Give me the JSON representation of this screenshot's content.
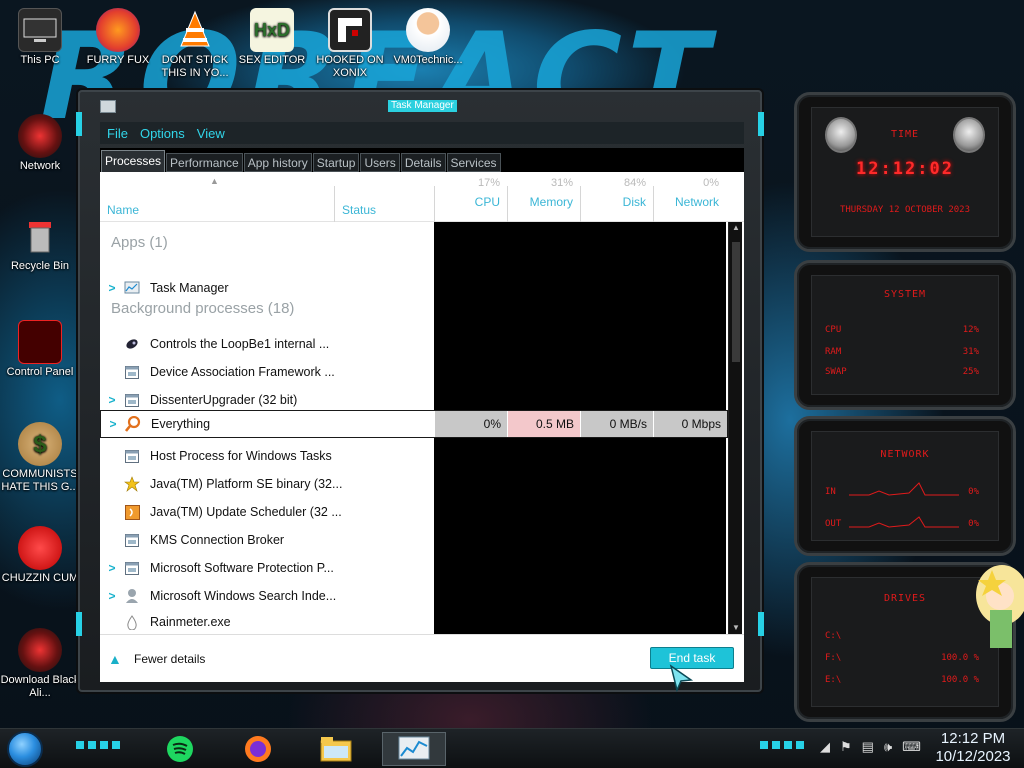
{
  "desktop": {
    "wallpaper_text": "ROREACT",
    "icons": [
      {
        "label": "This PC",
        "icon": "this-pc-icon"
      },
      {
        "label": "FURRY FUX",
        "icon": "firefox-icon"
      },
      {
        "label": "DONT STICK THIS IN YO...",
        "icon": "vlc-icon"
      },
      {
        "label": "SEX EDITOR",
        "icon": "hxd-editor-icon"
      },
      {
        "label": "HOOKED ON XONIX",
        "icon": "xonix-icon"
      },
      {
        "label": "VM0Technic...",
        "icon": "doctor-icon"
      },
      {
        "label": "Network",
        "icon": "network-icon"
      },
      {
        "label": "Recycle Bin",
        "icon": "recycle-bin-icon"
      },
      {
        "label": "Control Panel",
        "icon": "control-panel-icon"
      },
      {
        "label": "COMMUNISTS HATE THIS G...",
        "icon": "money-bag-icon"
      },
      {
        "label": "CHUZZIN CUM",
        "icon": "chuzzle-icon"
      },
      {
        "label": "Download Black Ali...",
        "icon": "alien-download-icon"
      }
    ]
  },
  "task_manager": {
    "title": "Task Manager",
    "menu": [
      "File",
      "Options",
      "View"
    ],
    "tabs": [
      "Processes",
      "Performance",
      "App history",
      "Startup",
      "Users",
      "Details",
      "Services"
    ],
    "active_tab": "Processes",
    "columns": {
      "name": "Name",
      "status": "Status",
      "cpu": {
        "label": "CPU",
        "pct": "17%"
      },
      "memory": {
        "label": "Memory",
        "pct": "31%"
      },
      "disk": {
        "label": "Disk",
        "pct": "84%"
      },
      "network": {
        "label": "Network",
        "pct": "0%"
      }
    },
    "groups": {
      "apps": "Apps (1)",
      "background": "Background processes (18)"
    },
    "processes": [
      {
        "name": "Task Manager",
        "expand": true,
        "icon": "task-manager-icon"
      },
      {
        "name": "Controls the LoopBe1 internal ...",
        "expand": false,
        "icon": "loopbe-icon"
      },
      {
        "name": "Device Association Framework ...",
        "expand": false,
        "icon": "service-window-icon"
      },
      {
        "name": "DissenterUpgrader (32 bit)",
        "expand": true,
        "icon": "service-window-icon"
      },
      {
        "name": "Everything",
        "expand": true,
        "icon": "magnifier-icon"
      },
      {
        "name": "Host Process for Windows Tasks",
        "expand": false,
        "icon": "service-window-icon"
      },
      {
        "name": "Java(TM) Platform SE binary (32...",
        "expand": false,
        "icon": "java-icon"
      },
      {
        "name": "Java(TM) Update Scheduler (32 ...",
        "expand": false,
        "icon": "java-update-icon"
      },
      {
        "name": "KMS Connection Broker",
        "expand": false,
        "icon": "service-window-icon"
      },
      {
        "name": "Microsoft Software Protection P...",
        "expand": true,
        "icon": "service-window-icon"
      },
      {
        "name": "Microsoft Windows Search Inde...",
        "expand": true,
        "icon": "search-user-icon"
      },
      {
        "name": "Rainmeter.exe",
        "expand": false,
        "icon": "raindrop-icon"
      }
    ],
    "selected": {
      "name": "Everything",
      "cpu": "0%",
      "memory": "0.5 MB",
      "disk": "0 MB/s",
      "network": "0 Mbps"
    },
    "footer": {
      "fewer_details": "Fewer details",
      "end_task": "End task"
    }
  },
  "widgets": {
    "time": {
      "title": "TIME",
      "clock": "12:12:02",
      "date": "THURSDAY 12 OCTOBER 2023"
    },
    "system": {
      "title": "SYSTEM",
      "rows": [
        {
          "label": "CPU",
          "value": "12%"
        },
        {
          "label": "RAM",
          "value": "31%"
        },
        {
          "label": "SWAP",
          "value": "25%"
        }
      ]
    },
    "network": {
      "title": "NETWORK",
      "rows": [
        {
          "label": "IN",
          "value": "0%"
        },
        {
          "label": "OUT",
          "value": "0%"
        }
      ]
    },
    "drives": {
      "title": "DRIVES",
      "rows": [
        {
          "label": "C:\\",
          "value": ""
        },
        {
          "label": "F:\\",
          "value": "100.0 %"
        },
        {
          "label": "E:\\",
          "value": "100.0 %"
        }
      ]
    }
  },
  "taskbar": {
    "pinned": [
      "spotify-icon",
      "firefox-icon",
      "file-explorer-icon",
      "task-manager-icon"
    ],
    "clock_time": "12:12 PM",
    "clock_date": "10/12/2023"
  },
  "colors": {
    "accent": "#27d1e6",
    "widget_red": "#e01b1b"
  }
}
